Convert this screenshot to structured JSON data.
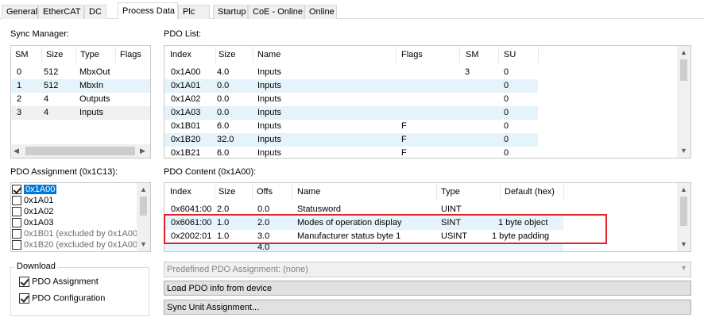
{
  "tabs": [
    {
      "label": "General",
      "left": 0
    },
    {
      "label": "EtherCAT"
    },
    {
      "label": "DC"
    },
    {
      "label": "Process Data",
      "active": true
    },
    {
      "label": "Plc"
    },
    {
      "label": "Startup"
    },
    {
      "label": "CoE - Online"
    },
    {
      "label": "Online"
    }
  ],
  "sync_manager": {
    "label": "Sync Manager:",
    "columns": [
      "SM",
      "Size",
      "Type",
      "Flags"
    ],
    "rows": [
      [
        "0",
        "512",
        "MbxOut",
        ""
      ],
      [
        "1",
        "512",
        "MbxIn",
        ""
      ],
      [
        "2",
        "4",
        "Outputs",
        ""
      ],
      [
        "3",
        "4",
        "Inputs",
        ""
      ]
    ]
  },
  "pdo_list": {
    "label": "PDO List:",
    "columns": [
      "Index",
      "Size",
      "Name",
      "Flags",
      "SM",
      "SU"
    ],
    "rows": [
      [
        "0x1A00",
        "4.0",
        "Inputs",
        "",
        "3",
        "0"
      ],
      [
        "0x1A01",
        "0.0",
        "Inputs",
        "",
        "",
        "0"
      ],
      [
        "0x1A02",
        "0.0",
        "Inputs",
        "",
        "",
        "0"
      ],
      [
        "0x1A03",
        "0.0",
        "Inputs",
        "",
        "",
        "0"
      ],
      [
        "0x1B01",
        "6.0",
        "Inputs",
        "F",
        "",
        "0"
      ],
      [
        "0x1B20",
        "32.0",
        "Inputs",
        "F",
        "",
        "0"
      ],
      [
        "0x1B21",
        "6.0",
        "Inputs",
        "F",
        "",
        "0"
      ]
    ]
  },
  "pdo_assignment": {
    "label": "PDO Assignment (0x1C13):",
    "items": [
      {
        "label": "0x1A00",
        "checked": true,
        "selected": true,
        "disabled": false
      },
      {
        "label": "0x1A01",
        "checked": false,
        "selected": false,
        "disabled": false
      },
      {
        "label": "0x1A02",
        "checked": false,
        "selected": false,
        "disabled": false
      },
      {
        "label": "0x1A03",
        "checked": false,
        "selected": false,
        "disabled": false
      },
      {
        "label": "0x1B01 (excluded by 0x1A00",
        "checked": false,
        "selected": false,
        "disabled": true
      },
      {
        "label": "0x1B20 (excluded by 0x1A00",
        "checked": false,
        "selected": false,
        "disabled": true
      }
    ]
  },
  "pdo_content": {
    "label": "PDO Content (0x1A00):",
    "columns": [
      "Index",
      "Size",
      "Offs",
      "Name",
      "Type",
      "Default (hex)"
    ],
    "rows": [
      [
        "0x6041:00",
        "2.0",
        "0.0",
        "Statusword",
        "UINT",
        ""
      ],
      [
        "0x6061:00",
        "1.0",
        "2.0",
        "Modes of operation display",
        "SINT",
        "1 byte object"
      ],
      [
        "0x2002:01",
        "1.0",
        "3.0",
        "Manufacturer status byte 1",
        "USINT",
        "1 byte padding"
      ],
      [
        "",
        "",
        "4.0",
        "",
        "",
        ""
      ]
    ]
  },
  "download": {
    "title": "Download",
    "options": [
      {
        "label": "PDO Assignment",
        "checked": true
      },
      {
        "label": "PDO Configuration",
        "checked": true
      }
    ]
  },
  "predefined": {
    "label": "Predefined PDO Assignment: (none)"
  },
  "buttons": {
    "load": "Load PDO info from device",
    "sync_unit": "Sync Unit Assignment..."
  },
  "icons": {
    "scroll_up": "▲",
    "scroll_down": "▼",
    "scroll_left": "◀",
    "scroll_right": "▶",
    "dropdown": "▼"
  },
  "colors": {
    "highlight_box": "#e0202a",
    "selection": "#0078d7",
    "row_hover": "#e5f3fb"
  }
}
